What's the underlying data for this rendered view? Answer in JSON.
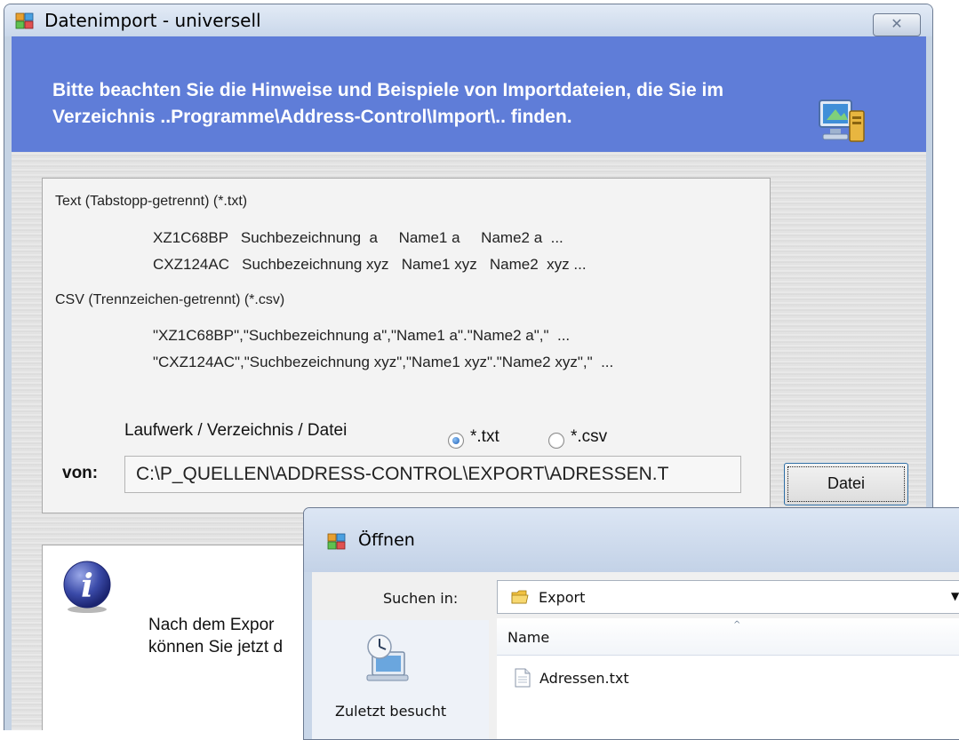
{
  "window": {
    "title": "Datenimport - universell",
    "close_symbol": "✕",
    "app_icon": "app-icon",
    "banner_text": "Bitte beachten Sie die Hinweise und Beispiele von Importdateien, die Sie im Verzeichnis ..Programme\\Address-Control\\Import\\.. finden.",
    "banner_icon": "import-computer-icon"
  },
  "examples": {
    "txt_header": "Text (Tabstopp-getrennt) (*.txt)",
    "txt_line1": "XZ1C68BP   Suchbezeichnung  a     Name1 a     Name2 a  ...",
    "txt_line2": "CXZ124AC   Suchbezeichnung xyz   Name1 xyz   Name2  xyz ...",
    "csv_header": "CSV (Trennzeichen-getrennt) (*.csv)",
    "csv_line1": "\"XZ1C68BP\",\"Suchbezeichnung a\",\"Name1 a\".\"Name2 a\",\"  ...",
    "csv_line2": "\"CXZ124AC\",\"Suchbezeichnung xyz\",\"Name1 xyz\".\"Name2 xyz\",\"  ..."
  },
  "source": {
    "path_label": "Laufwerk / Verzeichnis / Datei",
    "radio_txt": "*.txt",
    "radio_csv": "*.csv",
    "selected_type": "*.txt",
    "from_label": "von:",
    "path_value": "C:\\P_QUELLEN\\ADDRESS-CONTROL\\EXPORT\\ADRESSEN.T",
    "datei_button": "Datei"
  },
  "info": {
    "icon": "info-icon",
    "text": "Nach dem Expor\nkönnen Sie jetzt d"
  },
  "open_dialog": {
    "title": "Öffnen",
    "look_in_label": "Suchen in:",
    "look_in_value": "Export",
    "dropdown_arrow": "▼",
    "column_name": "Name",
    "sort_arrow": "^",
    "files": [
      "Adressen.txt"
    ],
    "places": [
      "Zuletzt besucht"
    ]
  },
  "colors": {
    "banner": "#5f7dd8",
    "titlebar": "#c9d7ea",
    "panel": "#f3f3f3"
  }
}
